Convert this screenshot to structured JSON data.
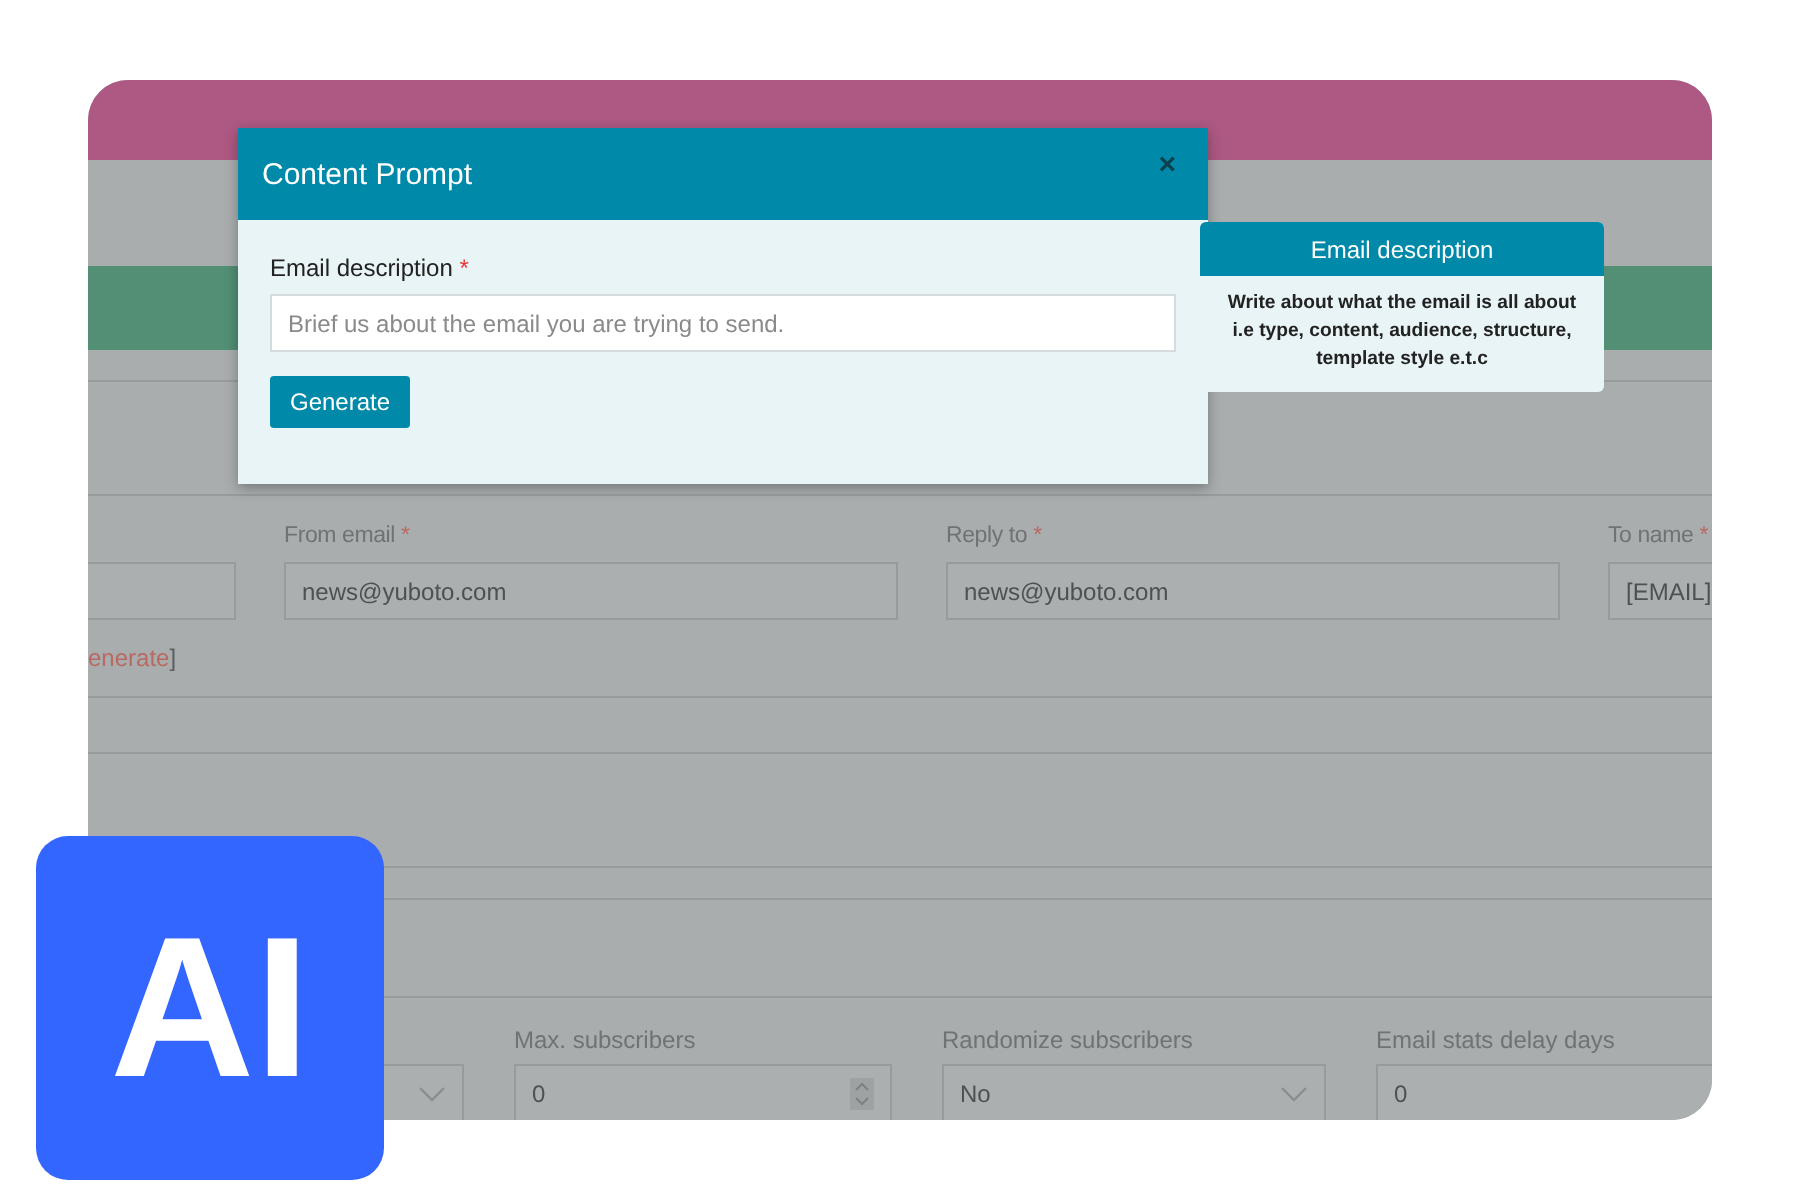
{
  "form_row": [
    {
      "kind": "text"
    },
    {
      "kind": "text",
      "label": "From email",
      "required_mark": "*",
      "value": "news@yuboto.com"
    },
    {
      "kind": "text",
      "label": "Reply to",
      "required_mark": "*",
      "value": "news@yuboto.com"
    },
    {
      "kind": "text",
      "label": "To name",
      "required_mark": "*",
      "value": "[EMAIL]"
    }
  ],
  "generate_link": {
    "text": "enerate",
    "suffix": "]"
  },
  "settings_row": [
    {
      "kind": "select"
    },
    {
      "kind": "number",
      "label": "Max. subscribers",
      "value": "0"
    },
    {
      "kind": "select",
      "label": "Randomize subscribers",
      "value": "No"
    },
    {
      "kind": "text",
      "label": "Email stats delay days",
      "value": "0"
    }
  ],
  "modal": {
    "title": "Content Prompt",
    "close": "×",
    "field": {
      "label": "Email description",
      "required_mark": "*",
      "placeholder": "Brief us about the email you are trying to send."
    },
    "button": "Generate"
  },
  "tooltip": {
    "title": "Email description",
    "text": "Write about what the email is all about i.e type, content, audience, structure, template style e.t.c"
  },
  "badge": {
    "text": "AI"
  }
}
